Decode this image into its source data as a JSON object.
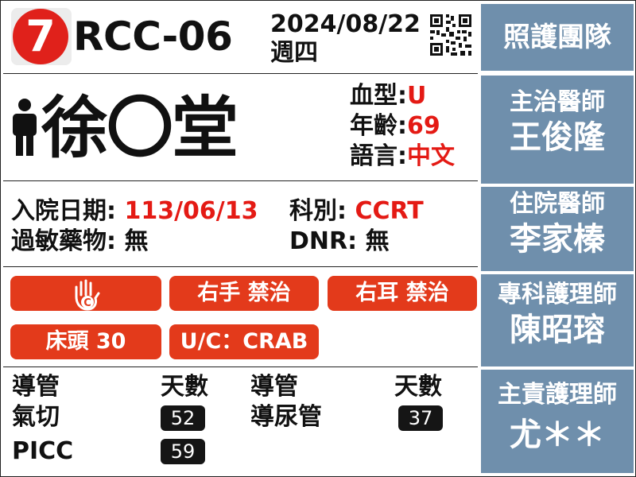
{
  "header": {
    "bed_number": "7",
    "room": "RCC-06",
    "date": "2024/08/22",
    "weekday": "週四"
  },
  "patient": {
    "name": "徐〇堂",
    "blood_type_label": "血型:",
    "blood_type": "U",
    "age_label": "年齡:",
    "age": "69",
    "language_label": "語言:",
    "language": "中文"
  },
  "admission": {
    "date_label": "入院日期:",
    "date": "113/06/13",
    "department_label": "科別:",
    "department": "CCRT",
    "allergy_label": "過敏藥物:",
    "allergy": "無",
    "dnr_label": "DNR:",
    "dnr": "無"
  },
  "alerts": {
    "contact_icon_letter": "C",
    "right_hand": "右手 禁治",
    "right_ear": "右耳 禁治",
    "bed_head": "床頭 30",
    "uc": "U/C：CRAB"
  },
  "catheters": {
    "header_catheter": "導管",
    "header_days": "天數",
    "left": [
      {
        "name": "氣切",
        "days": "52"
      },
      {
        "name": "PICC",
        "days": "59"
      }
    ],
    "right": [
      {
        "name": "導尿管",
        "days": "37"
      }
    ]
  },
  "care_team": {
    "title": "照護團隊",
    "members": [
      {
        "role": "主治醫師",
        "name": "王俊隆"
      },
      {
        "role": "住院醫師",
        "name": "李家榛"
      },
      {
        "role": "專科護理師",
        "name": "陳昭瑢"
      },
      {
        "role": "主責護理師",
        "name": "尤＊＊"
      }
    ]
  },
  "colors": {
    "accent_red": "#e0211b",
    "alert_red": "#e33a1b",
    "panel_blue": "#6f8fac"
  }
}
